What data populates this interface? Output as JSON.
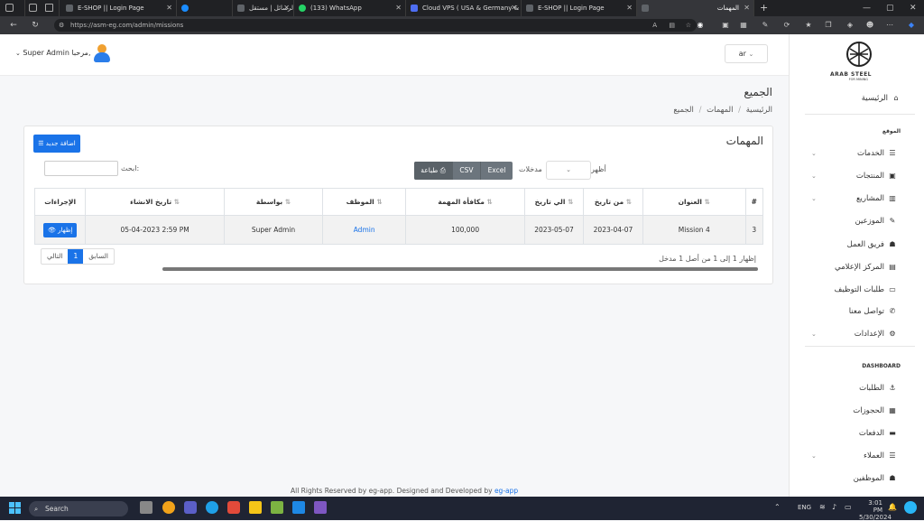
{
  "browser": {
    "tabs": [
      {
        "title": "E-SHOP || Login Page",
        "active": false
      },
      {
        "title": "",
        "active": false
      },
      {
        "title": "الرسائل | مستقل",
        "active": false
      },
      {
        "title": "(133) WhatsApp",
        "active": false
      },
      {
        "title": "Cloud VPS ( USA & Germany & I",
        "active": false
      },
      {
        "title": "E-SHOP || Login Page",
        "active": true
      },
      {
        "title": "المهمات",
        "active": true
      }
    ],
    "url": "https://asm-eg.com/admin/missions"
  },
  "topbar": {
    "greeting": "مرحبا,",
    "user": "Super Admin",
    "lang": "ar"
  },
  "sidebar": {
    "logo_text": "ARAB STEEL",
    "logo_sub": "FOR MINING",
    "home": "الرئيسية",
    "section_site": "الموقع",
    "items": [
      {
        "label": "الخدمات",
        "icon": "list-icon",
        "chevron": true
      },
      {
        "label": "المنتجات",
        "icon": "box-icon",
        "chevron": true
      },
      {
        "label": "المشاريع",
        "icon": "briefcase-icon",
        "chevron": true
      },
      {
        "label": "الموزعين",
        "icon": "pen-icon",
        "chevron": false
      },
      {
        "label": "فريق العمل",
        "icon": "team-icon",
        "chevron": false
      },
      {
        "label": "المركز الإعلامي",
        "icon": "media-icon",
        "chevron": false
      },
      {
        "label": "طلبات التوظيف",
        "icon": "jobs-icon",
        "chevron": false
      },
      {
        "label": "تواصل معنا",
        "icon": "phone-icon",
        "chevron": false
      },
      {
        "label": "الإعدادات",
        "icon": "gear-icon",
        "chevron": true
      }
    ],
    "section_dashboard": "DASHBOARD",
    "dash_items": [
      {
        "label": "الطلبات",
        "icon": "orders-icon",
        "chevron": false
      },
      {
        "label": "الحجوزات",
        "icon": "bookings-icon",
        "chevron": false
      },
      {
        "label": "الدفعات",
        "icon": "payments-icon",
        "chevron": false
      },
      {
        "label": "العملاء",
        "icon": "clients-icon",
        "chevron": true
      },
      {
        "label": "الموظفين",
        "icon": "staff-icon",
        "chevron": false
      }
    ]
  },
  "page": {
    "title": "الجميع",
    "breadcrumb": [
      "الرئيسية",
      "المهمات",
      "الجميع"
    ],
    "card_title": "المهمات",
    "add_button": "اضافة جديد",
    "show_label": "أظهر",
    "entries_label": "مدخلات",
    "export_buttons": [
      "Excel",
      "CSV",
      "طباعة"
    ],
    "search_label": "ابحث:",
    "search_value": "",
    "columns": [
      "#",
      "العنوان",
      "من تاريخ",
      "الي تاريخ",
      "مكافأة المهمة",
      "الموظف",
      "بواسطة",
      "تاريخ الانشاء",
      "الإجراءات"
    ],
    "rows": [
      {
        "id": "3",
        "title": "Mission 4",
        "from": "2023-04-07",
        "to": "2023-05-07",
        "reward": "100,000",
        "employee": "Admin",
        "by": "Super Admin",
        "created": "05-04-2023 2:59 PM",
        "action": "إظهار"
      }
    ],
    "info": "إظهار 1 إلى 1 من أصل 1 مدخل",
    "pagination": {
      "prev": "السابق",
      "current": "1",
      "next": "التالي"
    }
  },
  "footer": {
    "text": "All Rights Reserved by eg-app. Designed and Developed by",
    "link": "eg-app"
  },
  "taskbar": {
    "search": "Search",
    "lang": "ENG",
    "time": "3:01 PM",
    "date": "5/30/2024"
  },
  "colors": {
    "primary": "#1a73e8",
    "dark_button": "#6c757d",
    "chrome": "#202124"
  }
}
